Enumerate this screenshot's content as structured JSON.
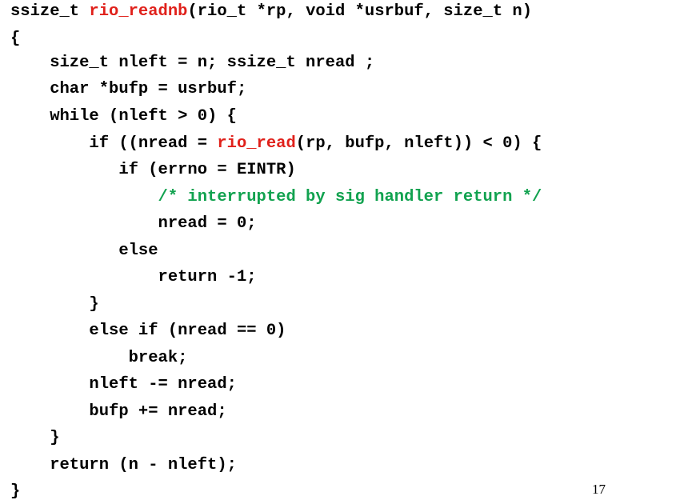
{
  "colors": {
    "text": "#000000",
    "function_name": "#e0201a",
    "comment": "#11a24f",
    "background": "#ffffff"
  },
  "code_lines": [
    [
      {
        "text": "ssize_t ",
        "color": "default"
      },
      {
        "text": "rio_readnb",
        "color": "red"
      },
      {
        "text": "(rio_t *rp, void *usrbuf, size_t n)",
        "color": "default"
      }
    ],
    [
      {
        "text": "{",
        "color": "default"
      }
    ],
    [
      {
        "text": "    size_t nleft = n; ssize_t nread ;",
        "color": "default"
      }
    ],
    [
      {
        "text": "    char *bufp = usrbuf;",
        "color": "default"
      }
    ],
    [
      {
        "text": "    while (nleft > 0) {",
        "color": "default"
      }
    ],
    [
      {
        "text": "        if ((nread = ",
        "color": "default"
      },
      {
        "text": "rio_read",
        "color": "red"
      },
      {
        "text": "(rp, bufp, nleft)) < 0) {",
        "color": "default"
      }
    ],
    [
      {
        "text": "           if (errno = EINTR)",
        "color": "default"
      }
    ],
    [
      {
        "text": "               ",
        "color": "default"
      },
      {
        "text": "/* interrupted by sig handler return */",
        "color": "green"
      }
    ],
    [
      {
        "text": "               nread = 0;",
        "color": "default"
      }
    ],
    [
      {
        "text": "           else",
        "color": "default"
      }
    ],
    [
      {
        "text": "               return -1;",
        "color": "default"
      }
    ],
    [
      {
        "text": "        }",
        "color": "default"
      }
    ],
    [
      {
        "text": "        else if (nread == 0)",
        "color": "default"
      }
    ],
    [
      {
        "text": "            break;",
        "color": "default"
      }
    ],
    [
      {
        "text": "        nleft -= nread;",
        "color": "default"
      }
    ],
    [
      {
        "text": "        bufp += nread;",
        "color": "default"
      }
    ],
    [
      {
        "text": "    }",
        "color": "default"
      }
    ],
    [
      {
        "text": "    return (n - nleft);",
        "color": "default"
      }
    ],
    [
      {
        "text": "}",
        "color": "default"
      }
    ]
  ],
  "page_number": "17"
}
